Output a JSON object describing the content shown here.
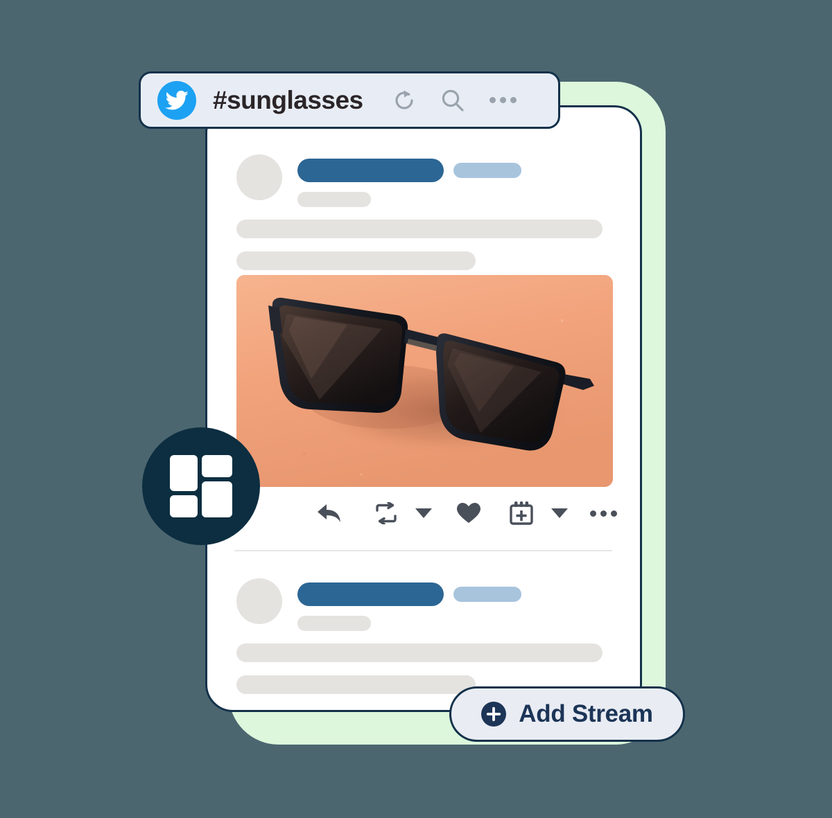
{
  "theme": {
    "page_background": "#4c6670",
    "accent_panel": "#ddf7dc",
    "card_background": "#ffffff",
    "card_border": "#13314a",
    "header_pill_background": "#e8edf5",
    "brand_navy": "#0c2e40",
    "twitter_blue": "#1da1f2",
    "skeleton_gray": "#e4e3e0",
    "skeleton_name_blue": "#2c6694",
    "skeleton_handle_blue": "#a8c4dd",
    "icon_gray": "#9aa3ad",
    "action_icon_gray": "#4a505a",
    "media_background": "#f2a87f",
    "button_text_navy": "#1c3557"
  },
  "stream_header": {
    "network_icon": "twitter-bird-icon",
    "title": "#sunglasses",
    "actions": [
      {
        "icon": "refresh-icon",
        "label": "Refresh"
      },
      {
        "icon": "search-icon",
        "label": "Search"
      },
      {
        "icon": "more-options-icon",
        "label": "More"
      }
    ]
  },
  "feed": {
    "posts": [
      {
        "avatar": "avatar-placeholder",
        "name_placeholder": "",
        "handle_placeholder": "",
        "meta_placeholder": "",
        "body_lines": [
          "",
          ""
        ],
        "media": {
          "icon": "sunglasses-photo",
          "alt": "Black sunglasses on a peach background"
        },
        "actions": [
          {
            "icon": "reply-icon",
            "label": "Reply"
          },
          {
            "icon": "retweet-icon",
            "label": "Retweet"
          },
          {
            "icon": "chevron-down-icon",
            "label": "Retweet options"
          },
          {
            "icon": "heart-icon",
            "label": "Like"
          },
          {
            "icon": "calendar-add-icon",
            "label": "Schedule"
          },
          {
            "icon": "chevron-down-icon",
            "label": "Schedule options"
          },
          {
            "icon": "more-options-icon",
            "label": "More"
          }
        ]
      },
      {
        "avatar": "avatar-placeholder",
        "name_placeholder": "",
        "handle_placeholder": "",
        "meta_placeholder": "",
        "body_lines": [
          "",
          ""
        ]
      }
    ]
  },
  "add_stream": {
    "icon": "plus-circle-icon",
    "label": "Add Stream"
  },
  "app_logo": {
    "icon": "app-grid-logo-icon",
    "tiles": 4
  }
}
